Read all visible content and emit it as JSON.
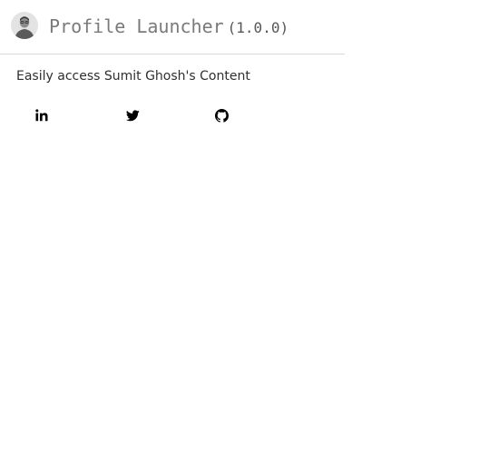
{
  "header": {
    "title": "Profile Launcher",
    "version": "(1.0.0)",
    "avatar_icon": "user-photo-avatar"
  },
  "main": {
    "description": "Easily access Sumit Ghosh's Content"
  },
  "links": [
    {
      "name": "linkedin",
      "icon": "linkedin-icon"
    },
    {
      "name": "twitter",
      "icon": "twitter-icon"
    },
    {
      "name": "github",
      "icon": "github-icon"
    }
  ],
  "colors": {
    "title": "#7a7a7a",
    "text": "#2f2f2f",
    "divider": "#d9d9d9",
    "icon": "#000000"
  }
}
